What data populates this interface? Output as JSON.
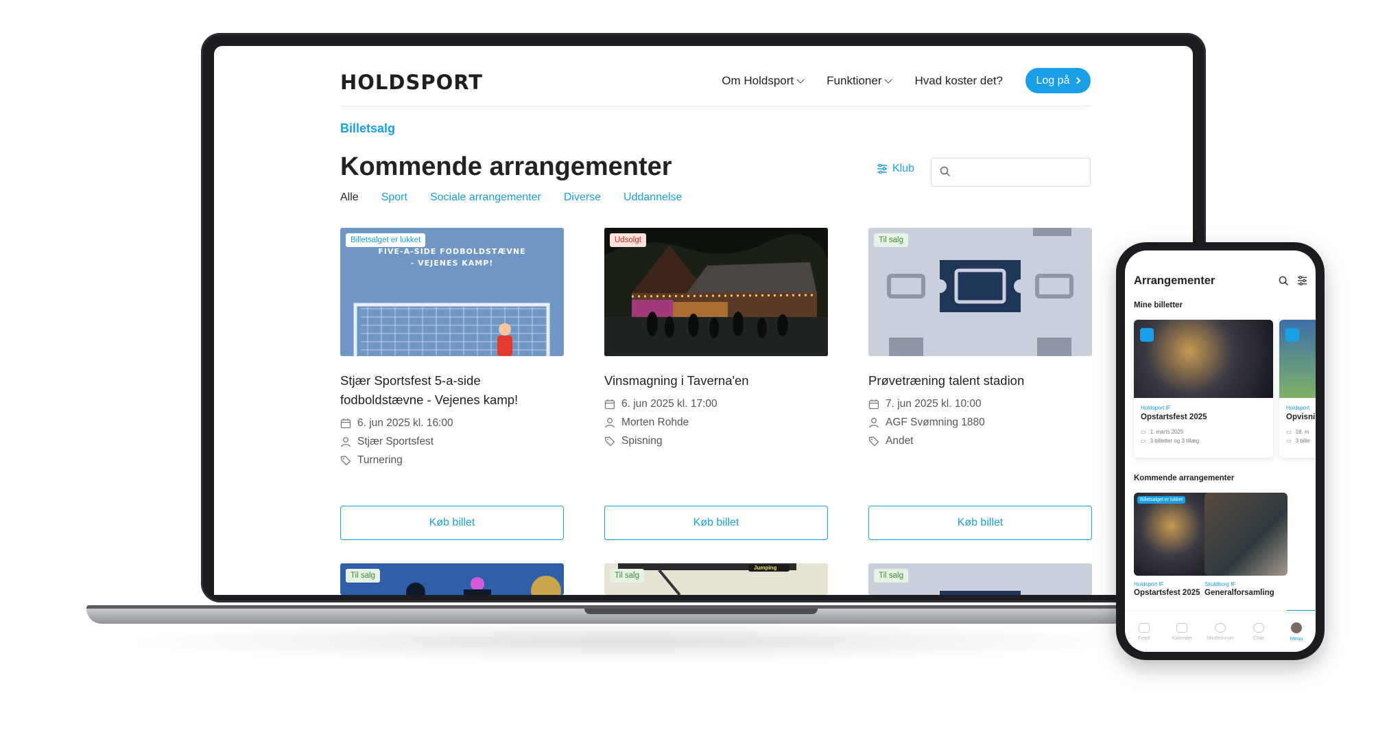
{
  "brand": {
    "logo": "HOLDSPORT",
    "accent": "#199fe6"
  },
  "nav": {
    "items": [
      "Om Holdsport",
      "Funktioner",
      "Hvad koster det?"
    ],
    "login": "Log på"
  },
  "page": {
    "breadcrumb": "Billetsalg",
    "title": "Kommende arrangementer",
    "filter_label": "Klub",
    "search_placeholder": "",
    "categories": [
      "Alle",
      "Sport",
      "Sociale arrangementer",
      "Diverse",
      "Uddannelse"
    ]
  },
  "events": [
    {
      "badge": "Billetsalget er lukket",
      "image_text_1": "FIVE-A-SIDE FODBOLDSTÆVNE",
      "image_text_2": "- VEJENES KAMP!",
      "title": "Stjær Sportsfest 5-a-side fodboldstævne - Vejenes kamp!",
      "date": "6. jun 2025 kl. 16:00",
      "organizer": "Stjær Sportsfest",
      "category": "Turnering",
      "button": "Køb billet"
    },
    {
      "badge": "Udsolgt",
      "title": "Vinsmagning i Taverna'en",
      "date": "6. jun 2025 kl. 17:00",
      "organizer": "Morten Rohde",
      "category": "Spisning",
      "button": "Køb billet"
    },
    {
      "badge": "Til salg",
      "title": "Prøvetræning talent stadion",
      "date": "7. jun 2025 kl. 10:00",
      "organizer": "AGF Svømning 1880",
      "category": "Andet",
      "button": "Køb billet"
    }
  ],
  "more_events": [
    {
      "badge": "Til salg"
    },
    {
      "badge": "Til salg",
      "image_text": "Jumping"
    },
    {
      "badge": "Til salg"
    }
  ],
  "phone": {
    "title": "Arrangementer",
    "my_tickets_label": "Mine billetter",
    "tickets": [
      {
        "club": "Holdsport IF",
        "name": "Opstartsfest 2025",
        "date": "1. marts 2025",
        "count": "3 billetter og 3 tillæg"
      },
      {
        "club": "Holdsport",
        "name": "Opvisni",
        "date": "18. m",
        "count": "3 bille"
      }
    ],
    "upcoming_label": "Kommende arrangementer",
    "upcoming": [
      {
        "badge": "Billetsalget er lukket",
        "club": "Holdsport IF",
        "name": "Opstartsfest 2025"
      },
      {
        "club": "Skuldborg IF",
        "name": "Generalforsamling"
      }
    ],
    "tabs": [
      "Feed",
      "Kalender",
      "Medlemmer",
      "Chat",
      "Menu"
    ]
  }
}
